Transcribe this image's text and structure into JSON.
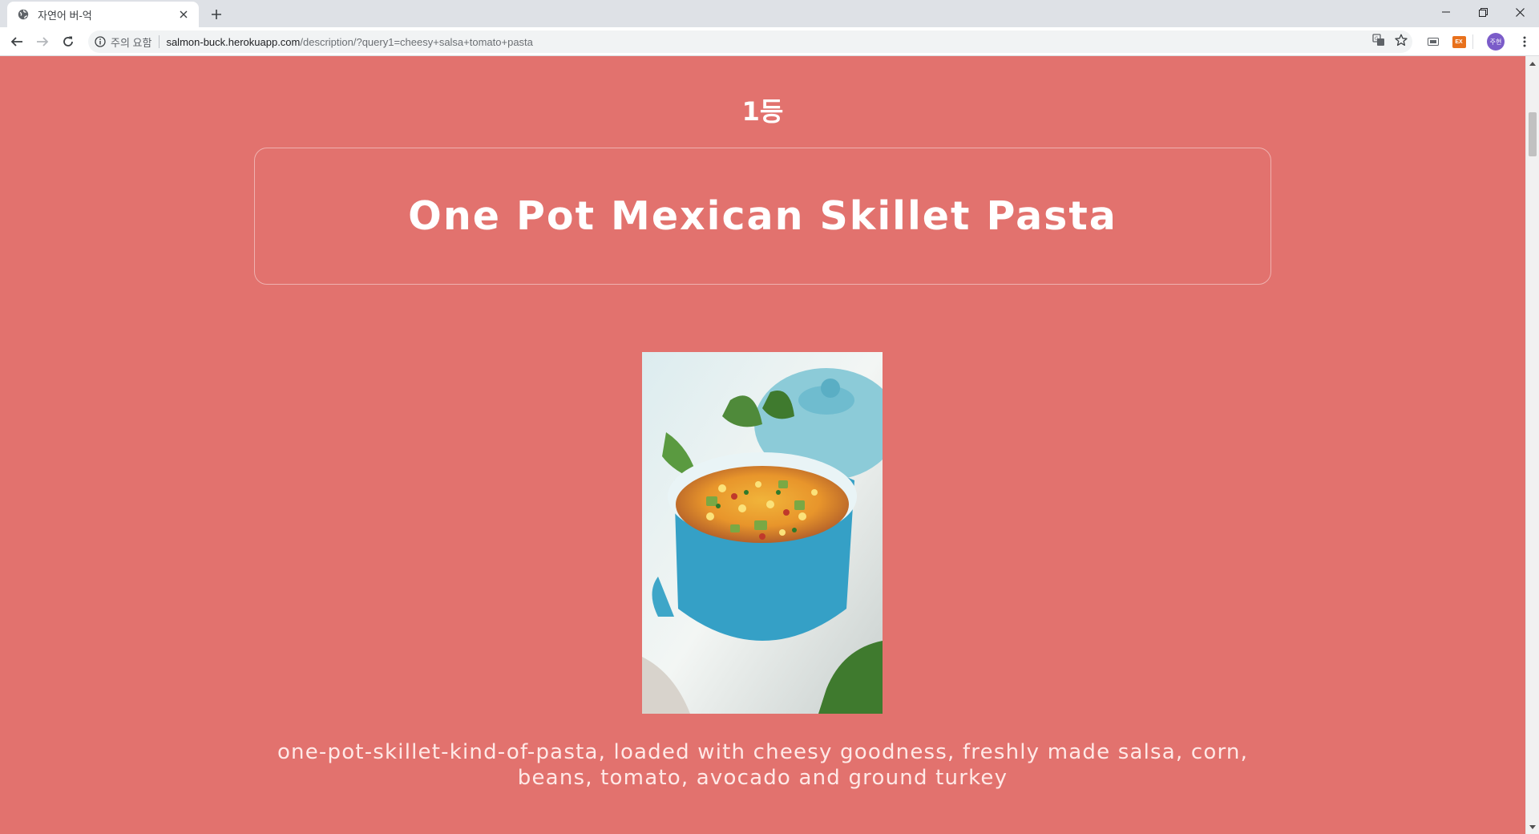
{
  "browser": {
    "tab_title": "자연어 버-억",
    "site_info": "주의 요함",
    "url_host": "salmon-buck.herokuapp.com",
    "url_rest": "/description/?query1=cheesy+salsa+tomato+pasta",
    "profile_initials": "주현",
    "extension_label": "EX"
  },
  "page": {
    "rank": "1등",
    "recipe_title": "One Pot Mexican Skillet Pasta",
    "description": "one-pot-skillet-kind-of-pasta, loaded with cheesy goodness, freshly made salsa, corn, beans, tomato, avocado and ground turkey",
    "background_color": "#e2726e"
  }
}
